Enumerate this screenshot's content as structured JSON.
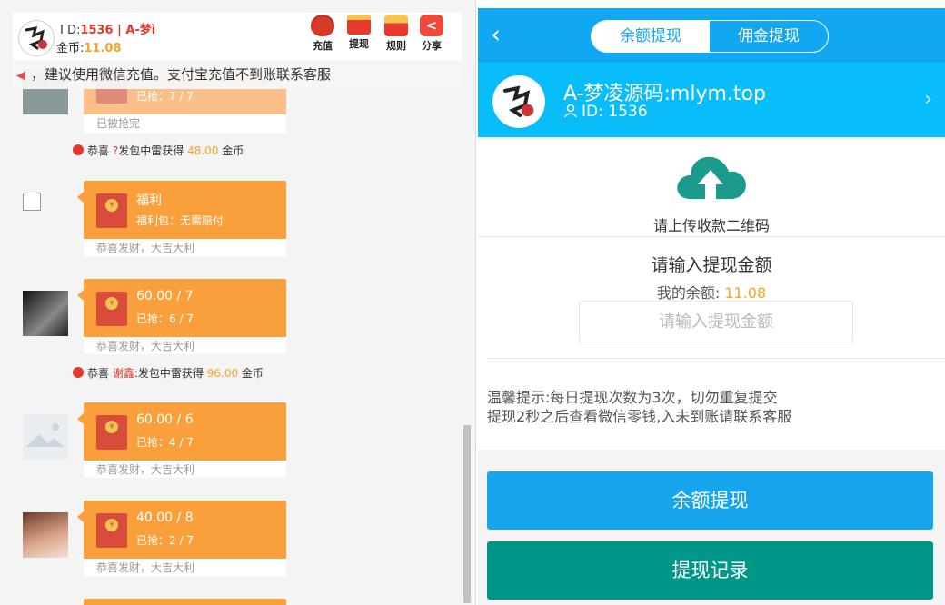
{
  "colors": {
    "red_packet": "#f9a03c",
    "header_blue": "#12a8f1",
    "profile_blue": "#09bdfb",
    "button_blue": "#17a6ee",
    "button_teal": "#009688",
    "highlight_yellow": "#f5a623",
    "highlight_red": "#e0382f"
  },
  "left": {
    "topbar": {
      "uid_label": "I D:",
      "uid_value": "1536 | A-梦ì",
      "gold_label": "金币:",
      "gold_value": "11.08",
      "buttons": [
        {
          "label": "充值",
          "icon": "money-bag-icon"
        },
        {
          "label": "提现",
          "icon": "red-envelope-icon"
        },
        {
          "label": "规则",
          "icon": "gift-icon"
        },
        {
          "label": "分享",
          "icon": "share-icon"
        }
      ]
    },
    "notice": "，建议使用微信充值。支付宝充值不到账联系客服",
    "messages": [
      {
        "t1": "",
        "t2": "已抢：7 / 7",
        "foot": "已被抢完"
      },
      {
        "t1": "福利",
        "t2": "福利包：无需赔付",
        "foot": "恭喜发财，大吉大利"
      },
      {
        "t1": "60.00 / 7",
        "t2": "已抢：6 / 7",
        "foot": "恭喜发财，大吉大利"
      },
      {
        "t1": "60.00 / 6",
        "t2": "已抢：4 / 7",
        "foot": "恭喜发财，大吉大利"
      },
      {
        "t1": "40.00 / 8",
        "t2": "已抢：2 / 7",
        "foot": "恭喜发财，大吉大利"
      }
    ],
    "system_messages": [
      {
        "prefix": "恭喜",
        "name": "?",
        "mid": "发包中雷获得",
        "amount": "48.00",
        "suffix": "金币"
      },
      {
        "prefix": "恭喜",
        "name": "谢鑫",
        "mid": ":发包中雷获得",
        "amount": "96.00",
        "suffix": "金币"
      }
    ]
  },
  "right": {
    "tabs": [
      {
        "label": "余额提现",
        "active": true
      },
      {
        "label": "佣金提现",
        "active": false
      }
    ],
    "profile": {
      "name": "A-梦凌源码:mlym.top",
      "id_label": "ID:",
      "id_value": "1536"
    },
    "upload_text": "请上传收款二维码",
    "amount_label": "请输入提现金额",
    "balance_label": "我的余额:",
    "balance_value": "11.08",
    "amount_placeholder": "请输入提现金额",
    "tips": [
      "温馨提示:每日提现次数为3次，切勿重复提交",
      "提现2秒之后查看微信零钱,入未到账请联系客服"
    ],
    "buttons": {
      "withdraw": "余额提现",
      "records": "提现记录"
    }
  }
}
